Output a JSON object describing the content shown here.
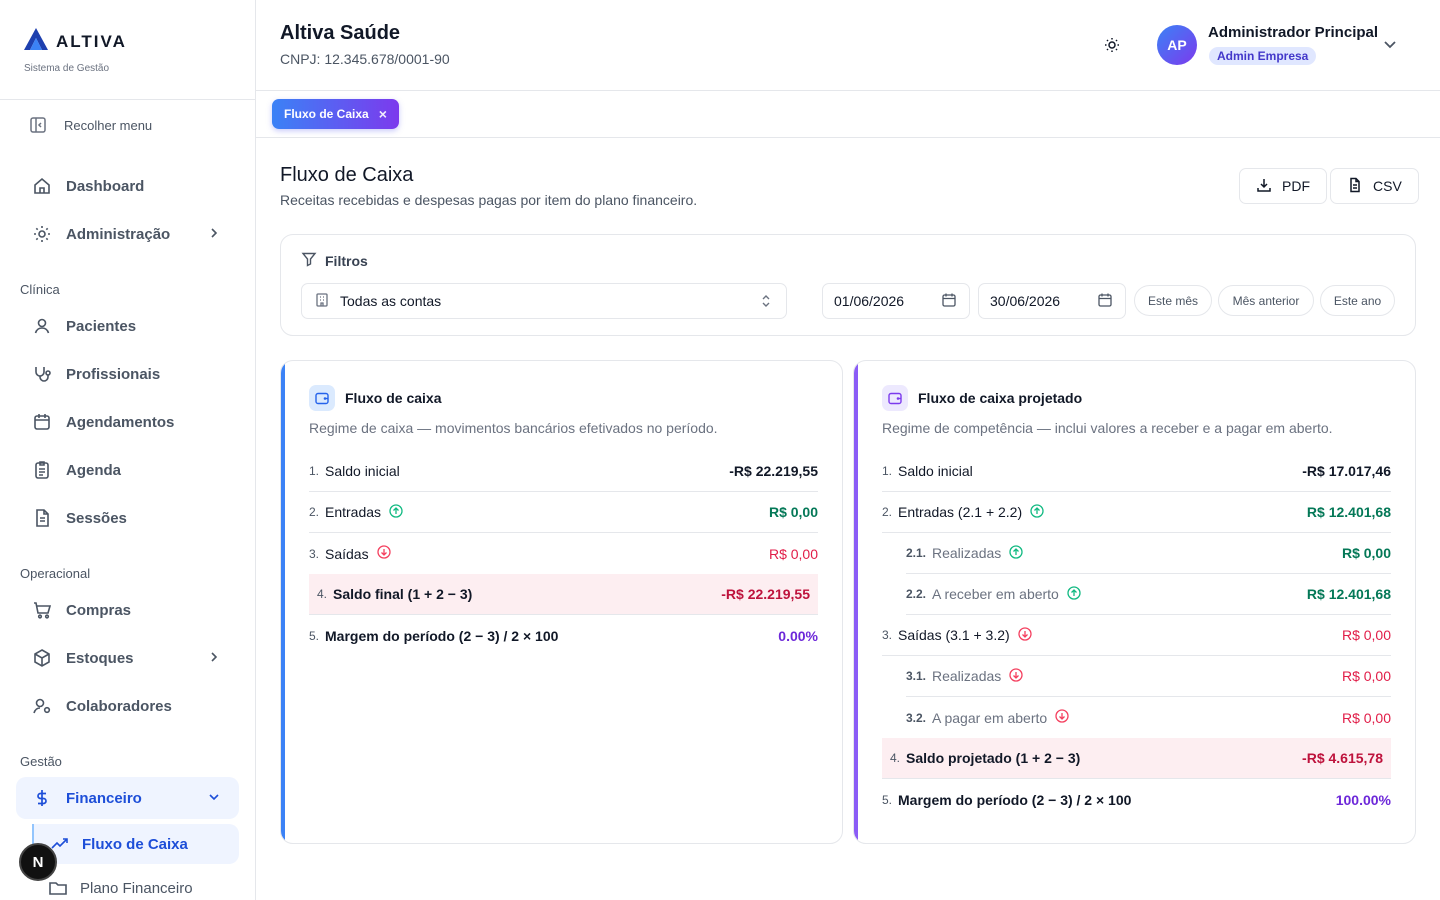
{
  "brand": {
    "name": "ALTIVA",
    "subtitle": "Sistema de Gestão"
  },
  "sidebar": {
    "collapse_label": "Recolher menu",
    "items": [
      {
        "label": "Dashboard"
      },
      {
        "label": "Administração"
      }
    ],
    "sections": [
      {
        "title": "Clínica",
        "items": [
          "Pacientes",
          "Profissionais",
          "Agendamentos",
          "Agenda",
          "Sessões"
        ]
      },
      {
        "title": "Operacional",
        "items": [
          "Compras",
          "Estoques",
          "Colaboradores"
        ]
      },
      {
        "title": "Gestão",
        "items": [
          "Financeiro"
        ]
      }
    ],
    "financeiro_sub": [
      "Fluxo de Caixa",
      "Plano Financeiro"
    ],
    "badge": "N"
  },
  "header": {
    "company": "Altiva Saúde",
    "cnpj": "CNPJ: 12.345.678/0001-90",
    "user_initials": "AP",
    "user_name": "Administrador Principal",
    "user_role": "Admin Empresa"
  },
  "tabs": [
    {
      "label": "Fluxo de Caixa",
      "close": "×"
    }
  ],
  "page": {
    "title": "Fluxo de Caixa",
    "subtitle": "Receitas recebidas e despesas pagas por item do plano financeiro.",
    "pdf_label": "PDF",
    "csv_label": "CSV"
  },
  "filters": {
    "title": "Filtros",
    "account": "Todas as contas",
    "date_from": "01/06/2026",
    "date_to": "30/06/2026",
    "quick": [
      "Este mês",
      "Mês anterior",
      "Este ano"
    ]
  },
  "card_cash": {
    "title": "Fluxo de caixa",
    "description": "Regime de caixa — movimentos bancários efetivados no período.",
    "rows": [
      {
        "num": "1.",
        "label": "Saldo inicial",
        "value": "-R$ 22.219,55"
      },
      {
        "num": "2.",
        "label": "Entradas",
        "value": "R$ 0,00"
      },
      {
        "num": "3.",
        "label": "Saídas",
        "value": "R$ 0,00"
      },
      {
        "num": "4.",
        "label": "Saldo final (1 + 2 − 3)",
        "value": "-R$ 22.219,55"
      },
      {
        "num": "5.",
        "label": "Margem do período (2 − 3) / 2 × 100",
        "value": "0.00%"
      }
    ]
  },
  "card_projected": {
    "title": "Fluxo de caixa projetado",
    "description": "Regime de competência — inclui valores a receber e a pagar em aberto.",
    "rows": [
      {
        "num": "1.",
        "label": "Saldo inicial",
        "value": "-R$ 17.017,46"
      },
      {
        "num": "2.",
        "label": "Entradas (2.1 + 2.2)",
        "value": "R$ 12.401,68"
      },
      {
        "num": "2.1.",
        "label": "Realizadas",
        "value": "R$ 0,00"
      },
      {
        "num": "2.2.",
        "label": "A receber em aberto",
        "value": "R$ 12.401,68"
      },
      {
        "num": "3.",
        "label": "Saídas (3.1 + 3.2)",
        "value": "R$ 0,00"
      },
      {
        "num": "3.1.",
        "label": "Realizadas",
        "value": "R$ 0,00"
      },
      {
        "num": "3.2.",
        "label": "A pagar em aberto",
        "value": "R$ 0,00"
      },
      {
        "num": "4.",
        "label": "Saldo projetado (1 + 2 − 3)",
        "value": "-R$ 4.615,78"
      },
      {
        "num": "5.",
        "label": "Margem do período (2 − 3) / 2 × 100",
        "value": "100.00%"
      }
    ]
  },
  "colors": {
    "accent": "#3b82f6",
    "purple": "#8b5cf6",
    "positive": "#047857",
    "negative": "#e11d48"
  }
}
